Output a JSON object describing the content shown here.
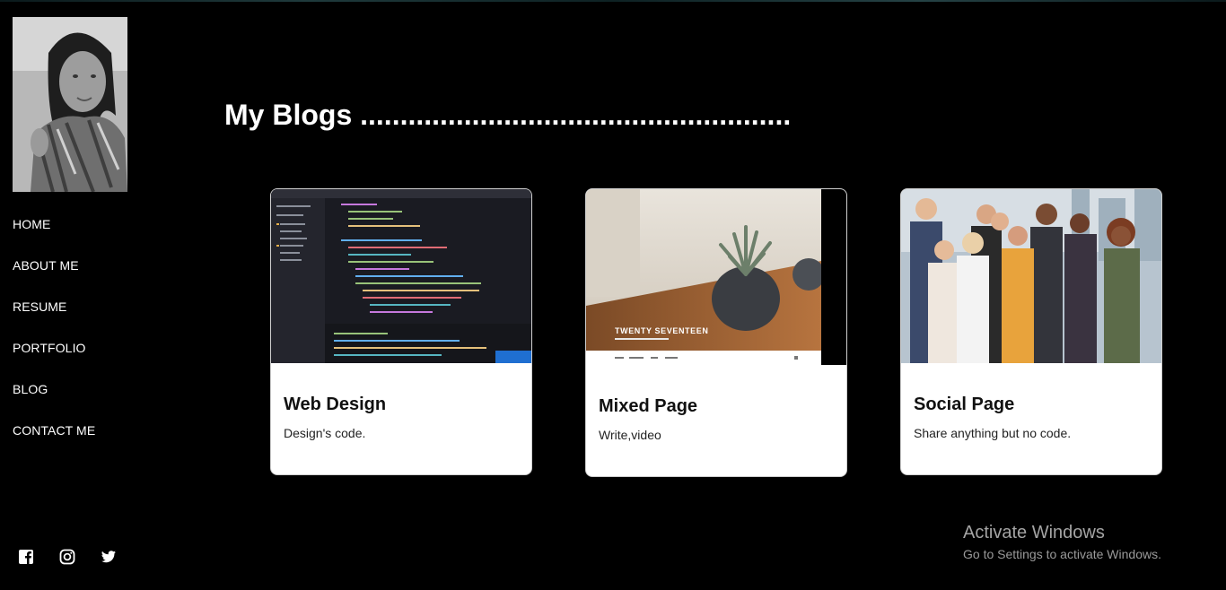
{
  "sidebar": {
    "nav": [
      {
        "label": "HOME"
      },
      {
        "label": "ABOUT ME"
      },
      {
        "label": "RESUME"
      },
      {
        "label": "PORTFOLIO"
      },
      {
        "label": "BLOG"
      },
      {
        "label": "CONTACT ME"
      }
    ],
    "socials": [
      "facebook-icon",
      "instagram-icon",
      "twitter-icon"
    ]
  },
  "main": {
    "heading": "My Blogs",
    "heading_dots": "......................................................",
    "cards": [
      {
        "title": "Web Design",
        "description": "Design's code.",
        "image": "code-editor-screenshot"
      },
      {
        "title": "Mixed Page",
        "description": "Write,video",
        "image": "twenty-seventeen-theme-preview",
        "image_caption": "TWENTY SEVENTEEN"
      },
      {
        "title": "Social Page",
        "description": "Share anything but no code.",
        "image": "group-of-people-photo"
      }
    ]
  },
  "watermark": {
    "line1": "Activate Windows",
    "line2": "Go to Settings to activate Windows."
  },
  "colors": {
    "background": "#000000",
    "card": "#ffffff",
    "text": "#ffffff"
  }
}
